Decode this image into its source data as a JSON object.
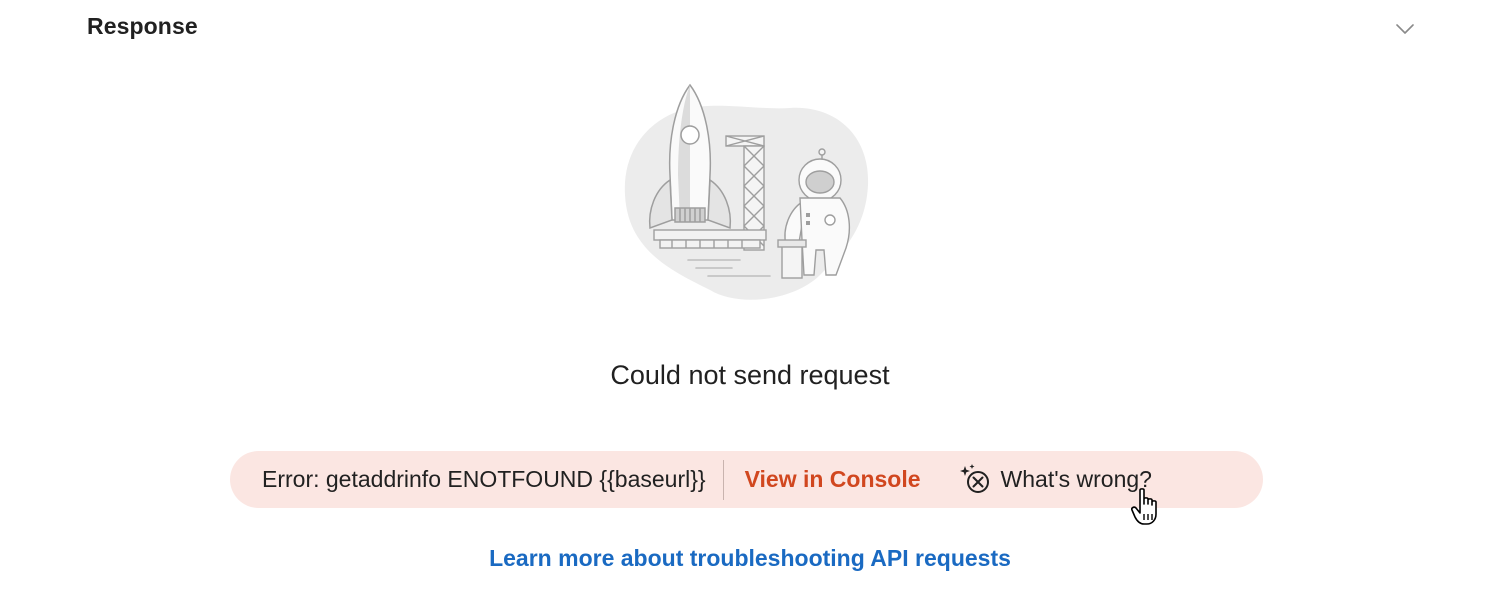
{
  "header": {
    "title": "Response",
    "collapse_icon": "chevron-down-icon"
  },
  "illustration": {
    "icon": "rocket-astronaut-illustration"
  },
  "empty_state": {
    "message": "Could not send request"
  },
  "error_bar": {
    "error_text": "Error: getaddrinfo ENOTFOUND {{baseurl}}",
    "console_link": "View in Console",
    "whats_wrong_label": "What's wrong?",
    "whats_wrong_icon": "ai-sparkle-icon",
    "accent_color": "#d1471f",
    "background_color": "#fbe6e2"
  },
  "footer": {
    "learn_more_link": "Learn more about troubleshooting API requests",
    "link_color": "#1a6ac2"
  },
  "pointer": {
    "icon": "hand-pointer-cursor-icon"
  }
}
